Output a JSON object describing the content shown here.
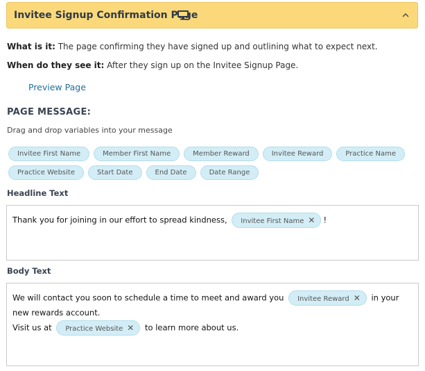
{
  "header": {
    "title": "Invitee Signup Confirmation Page",
    "icon": "monitor-icon",
    "collapse_icon": "chevron-up-icon"
  },
  "info": {
    "what_label": "What is it:",
    "what_text": " The page confirming they have signed up and outlining what to expect next.",
    "when_label": "When do they see it:",
    "when_text": " After they sign up on the Invitee Signup Page."
  },
  "preview_link": "Preview Page",
  "page_message": {
    "title": "PAGE MESSAGE:",
    "hint": "Drag and drop variables into your message",
    "variables_row1": [
      "Invitee First Name",
      "Member First Name",
      "Member Reward",
      "Invitee Reward",
      "Practice Name"
    ],
    "variables_row2": [
      "Practice Website",
      "Start Date",
      "End Date",
      "Date Range"
    ]
  },
  "headline": {
    "label": "Headline Text",
    "text_before": "Thank you for joining in our effort to spread kindness,",
    "chip": "Invitee First Name",
    "text_after": "!"
  },
  "body": {
    "label": "Body Text",
    "line1_before": "We will contact you soon to schedule a time to meet and award you",
    "chip1": "Invitee Reward",
    "line1_after": "in your new rewards account.",
    "line2_before": "Visit us at",
    "chip2": "Practice Website",
    "line2_after": "to learn more about us."
  },
  "chip_remove_symbol": "✕",
  "colors": {
    "header_bg": "#fbd97a",
    "chip_bg": "#d3edf6",
    "link": "#1f6f99"
  }
}
